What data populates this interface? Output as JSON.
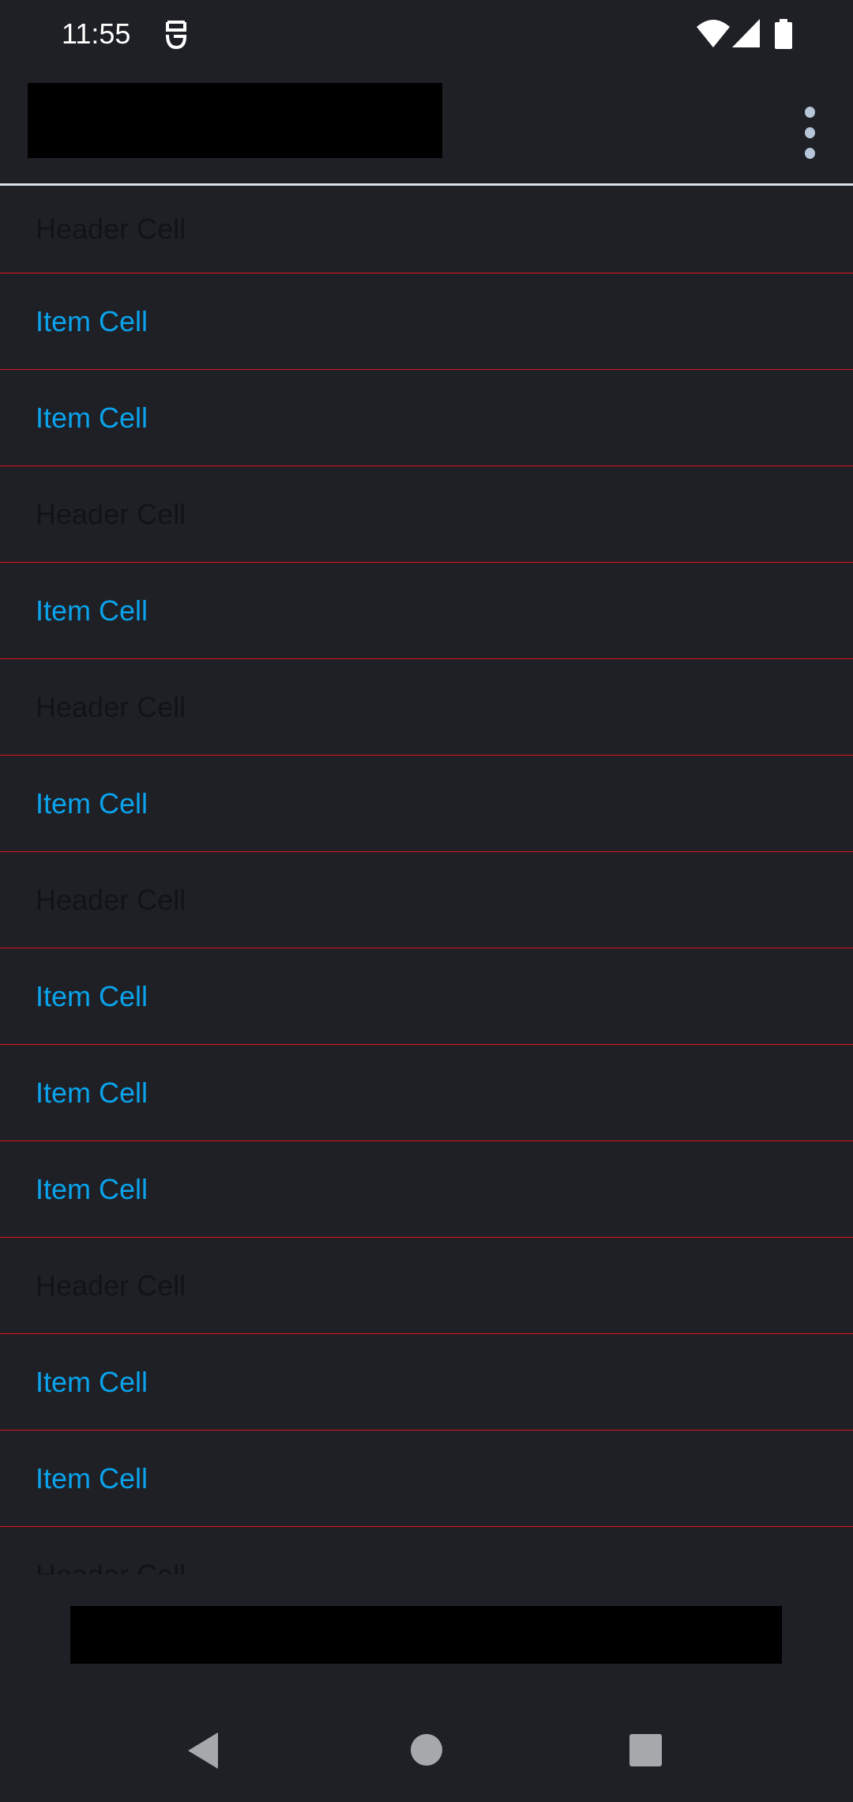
{
  "status_bar": {
    "time": "11:55",
    "icons": [
      "app-notification-icon",
      "wifi-icon",
      "signal-icon",
      "battery-icon"
    ]
  },
  "toolbar": {
    "title": "",
    "menu_icon": "more-vert-icon"
  },
  "list": {
    "rows": [
      {
        "type": "header",
        "label": "Header Cell"
      },
      {
        "type": "item",
        "label": "Item Cell"
      },
      {
        "type": "item",
        "label": "Item Cell"
      },
      {
        "type": "header",
        "label": "Header Cell"
      },
      {
        "type": "item",
        "label": "Item Cell"
      },
      {
        "type": "header",
        "label": "Header Cell"
      },
      {
        "type": "item",
        "label": "Item Cell"
      },
      {
        "type": "header",
        "label": "Header Cell"
      },
      {
        "type": "item",
        "label": "Item Cell"
      },
      {
        "type": "item",
        "label": "Item Cell"
      },
      {
        "type": "item",
        "label": "Item Cell"
      },
      {
        "type": "header",
        "label": "Header Cell"
      },
      {
        "type": "item",
        "label": "Item Cell"
      },
      {
        "type": "item",
        "label": "Item Cell"
      },
      {
        "type": "header",
        "label": "Header Cell"
      }
    ]
  },
  "colors": {
    "background": "#1e2026",
    "item_text": "#0aa3ec",
    "header_text": "#121316",
    "divider": "#e0141b"
  },
  "nav_bar": {
    "icons": [
      "back-icon",
      "home-icon",
      "recents-icon"
    ]
  }
}
